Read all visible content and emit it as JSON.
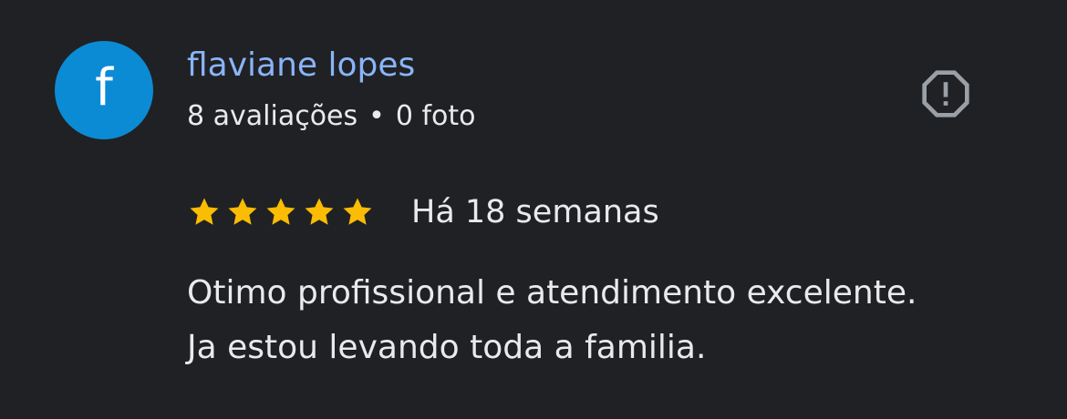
{
  "review": {
    "author": {
      "initial": "f",
      "name": "flaviane lopes",
      "reviews_count": "8 avaliações",
      "separator": "•",
      "photos_count": "0 foto",
      "avatar_color": "#0b8bd4"
    },
    "rating": {
      "stars": 5,
      "max": 5,
      "star_color": "#fbbc04"
    },
    "date": "Há 18 semanas",
    "text_lines": [
      "Otimo profissional e atendimento excelente.",
      "Ja estou levando toda a familia."
    ],
    "report_icon": "report-flag-icon"
  },
  "theme": {
    "background": "#202124",
    "name_color": "#8ab4f8",
    "text_color": "#e8eaed",
    "icon_color": "#9aa0a6"
  }
}
